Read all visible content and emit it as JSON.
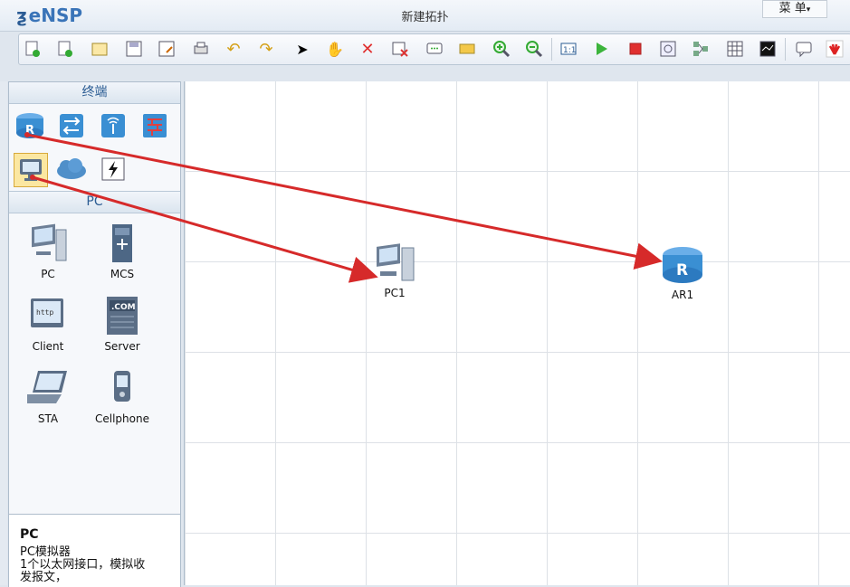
{
  "app": {
    "logo": "eNSP",
    "window_title": "新建拓扑",
    "menu_label": "菜 单"
  },
  "toolbar": {
    "buttons": [
      "new-topology-icon",
      "new-lab-icon",
      "open-icon",
      "save-icon",
      "save-as-icon",
      "print-icon",
      "undo-icon",
      "redo-icon",
      "select-icon",
      "pan-hand-icon",
      "delete-icon",
      "delete-link-icon",
      "text-note-icon",
      "rectangle-icon",
      "zoom-in-icon",
      "zoom-out-icon",
      "fit-view-icon",
      "start-device-icon",
      "stop-device-icon",
      "capture-icon",
      "topology-icon",
      "grid-icon",
      "console-icon",
      "chat-icon",
      "huawei-icon"
    ]
  },
  "panel": {
    "category_title": "终端",
    "categories": [
      "router-icon",
      "switch-icon",
      "wireless-icon",
      "firewall-icon",
      "pc-icon",
      "cloud-icon",
      "power-link-icon"
    ],
    "device_section_title": "PC",
    "devices": [
      {
        "label": "PC",
        "icon": "pc-icon"
      },
      {
        "label": "MCS",
        "icon": "mcs-server-icon"
      },
      {
        "label": "Client",
        "icon": "client-icon"
      },
      {
        "label": "Server",
        "icon": "server-icon"
      },
      {
        "label": "STA",
        "icon": "laptop-icon"
      },
      {
        "label": "Cellphone",
        "icon": "cellphone-icon"
      }
    ],
    "description": {
      "title": "PC",
      "lines": [
        "PC模拟器",
        "1个以太网接口，模拟收",
        "发报文，"
      ]
    }
  },
  "canvas": {
    "nodes": [
      {
        "label": "PC1",
        "icon": "pc-icon"
      },
      {
        "label": "AR1",
        "icon": "router-icon"
      }
    ]
  },
  "colors": {
    "accent": "#2b5c93",
    "arrow": "#d62a2a",
    "router": "#3a8fd3"
  }
}
